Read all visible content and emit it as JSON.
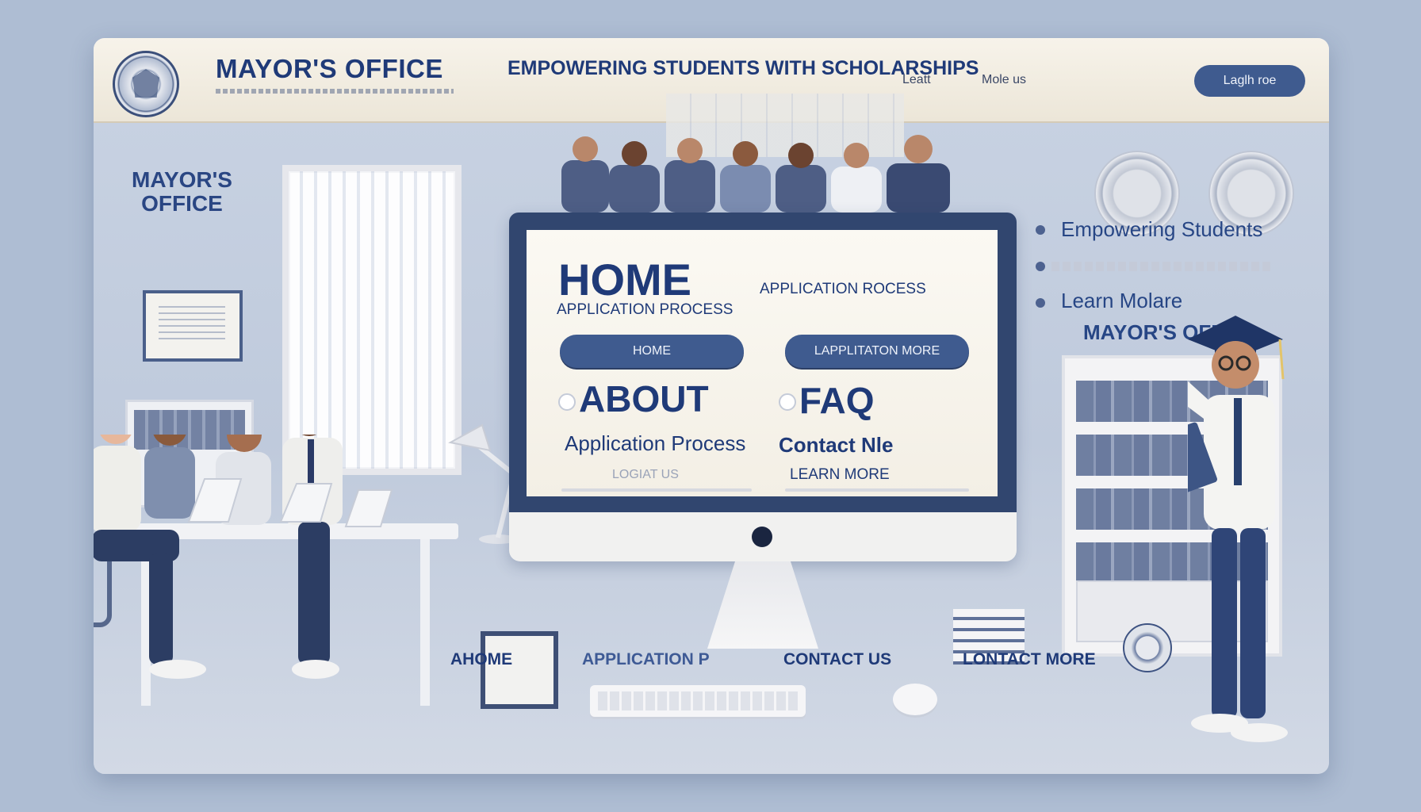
{
  "header": {
    "brand": "MAYOR'S OFFICE",
    "tagline": "EMPOWERING STUDENTS WITH SCHOLARSHIPS",
    "nav": [
      "Leatt",
      "Mole us"
    ],
    "login_button": "Laglh roe"
  },
  "side_label": {
    "line1": "MAYOR'S",
    "line2": "OFFICE"
  },
  "screen": {
    "home_title": "HOME",
    "application_process_sub": "APPLICATION PROCESS",
    "application_process_right": "APPLICATION ROCESS",
    "home_button": "HOME",
    "learn_more_button": "LAPPLITATON MORE",
    "about": "ABOUT",
    "faq": "FAQ",
    "application_process": "Application Process",
    "contact_me": "Contact Nle",
    "locate_us": "LOGIAT US",
    "learn_more": "LEARN MORE"
  },
  "right_panel": {
    "items": [
      "Empowering Students",
      "Learn Molare"
    ],
    "mayor_office": "MAYOR'S OFFCE"
  },
  "footer_nav": [
    "AHOME",
    "APPLICATION P",
    "CONTACT US",
    "LONTACT MORE"
  ],
  "colors": {
    "brand_blue": "#1f3a78",
    "button_blue": "#3f5b8f",
    "background": "#aebdd3",
    "header_bg": "#f7f3ea"
  }
}
